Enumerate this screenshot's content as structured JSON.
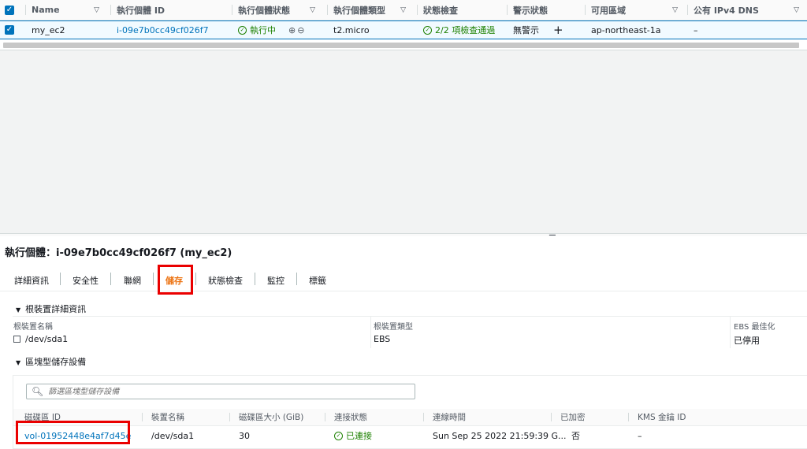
{
  "instances_table": {
    "columns": [
      {
        "label": "Name",
        "sortable": true
      },
      {
        "label": "執行個體 ID",
        "sortable": false
      },
      {
        "label": "執行個體狀態",
        "sortable": true
      },
      {
        "label": "執行個體類型",
        "sortable": true
      },
      {
        "label": "狀態檢查",
        "sortable": false
      },
      {
        "label": "警示狀態",
        "sortable": false
      },
      {
        "label": "可用區域",
        "sortable": true
      },
      {
        "label": "公有 IPv4 DNS",
        "sortable": true
      }
    ],
    "sort_icon": "▽",
    "row": {
      "name": "my_ec2",
      "instance_id": "i-09e7b0cc49cf026f7",
      "state": "執行中",
      "type": "t2.micro",
      "status_check": "2/2 項檢查通過",
      "alarm": "無警示",
      "zone": "ap-northeast-1a",
      "dns": "–"
    },
    "checkbox_mark": "✓"
  },
  "details": {
    "title": "執行個體：i-09e7b0cc49cf026f7 (my_ec2)",
    "tabs": [
      "詳細資訊",
      "安全性",
      "聯網",
      "儲存",
      "狀態檢查",
      "監控",
      "標籤"
    ],
    "active_tab": "儲存",
    "root_section": {
      "heading": "根裝置詳細資訊",
      "fields": [
        {
          "label": "根裝置名稱",
          "value": "/dev/sda1"
        },
        {
          "label": "根裝置類型",
          "value": "EBS"
        },
        {
          "label": "EBS 最佳化",
          "value": "已停用"
        }
      ]
    },
    "block_section": {
      "heading": "區塊型儲存設備",
      "search_placeholder": "篩選區塊型儲存設備",
      "columns": [
        "磁碟區 ID",
        "裝置名稱",
        "磁碟區大小 (GiB)",
        "連接狀態",
        "連線時間",
        "已加密",
        "KMS 金鑰 ID"
      ],
      "row": {
        "volume_id": "vol-01952448e4af7d45e",
        "device": "/dev/sda1",
        "size": "30",
        "attach_state": "已連接",
        "attach_time": "Sun Sep 25 2022 21:59:39 G...",
        "encrypted": "否",
        "kms": "–"
      }
    }
  },
  "colors": {
    "accent": "#0073bb",
    "ok": "#1d8102",
    "active_tab": "#ec7211",
    "highlight_box": "#ea0000"
  }
}
